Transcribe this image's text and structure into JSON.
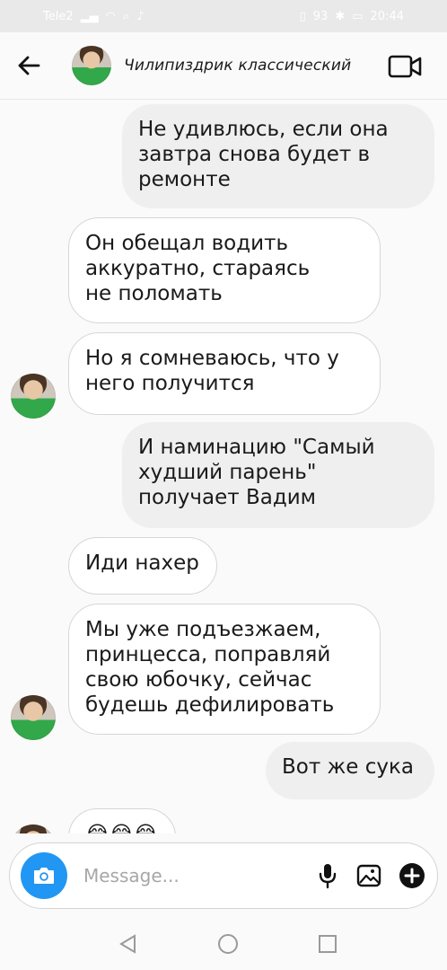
{
  "status_bar": {
    "carrier": "Tele2",
    "battery": "93",
    "time": "20:44"
  },
  "header": {
    "contact_name": "Чилипиздрик классический"
  },
  "messages": [
    {
      "direction": "out",
      "text": "Не удивлюсь, если она\nзавтра снова будет в\nремонте"
    },
    {
      "direction": "in",
      "text": "Он обещал водить\nаккуратно, стараясь\nне поломать"
    },
    {
      "direction": "in",
      "text": "Но я сомневаюсь, что у\nнего получится"
    },
    {
      "direction": "out",
      "text": "И наминацию \"Самый\nхудший парень\"\nполучает Вадим"
    },
    {
      "direction": "in",
      "text": "Иди нахер"
    },
    {
      "direction": "in",
      "text": "Мы уже подъезжаем,\nпринцесса, поправляй\nсвою юбочку, сейчас\nбудешь дефилировать"
    },
    {
      "direction": "out",
      "text": "Вот же сука"
    },
    {
      "direction": "in",
      "text": "😂😂😂"
    }
  ],
  "composer": {
    "placeholder": "Message..."
  },
  "colors": {
    "accent": "#2196f3",
    "outgoing_bubble": "#efefef",
    "incoming_border": "#d6d6d6"
  }
}
